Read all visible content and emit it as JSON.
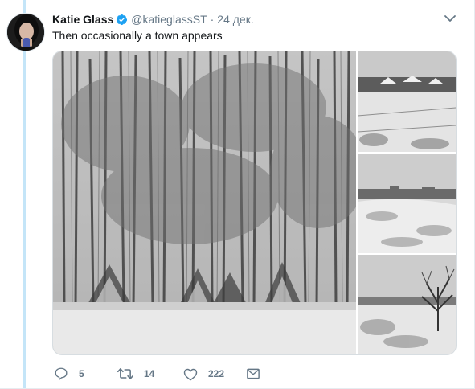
{
  "tweet": {
    "author_name": "Katie Glass",
    "author_handle": "@katieglassST",
    "separator": "·",
    "timestamp": "24 дек.",
    "text": "Then occasionally a town appears",
    "verified": true
  },
  "media": {
    "photos": [
      {
        "subject": "snowy birch forest"
      },
      {
        "subject": "snowy village houses"
      },
      {
        "subject": "snowy field with village"
      },
      {
        "subject": "snowy field with bare tree"
      }
    ]
  },
  "actions": {
    "reply_count": "5",
    "retweet_count": "14",
    "like_count": "222"
  },
  "icons": {
    "verified": "verified-badge-icon",
    "caret": "chevron-down-icon",
    "reply": "reply-icon",
    "retweet": "retweet-icon",
    "like": "heart-icon",
    "dm": "envelope-icon"
  },
  "colors": {
    "verified_blue": "#1da1f2",
    "secondary_text": "#657786",
    "primary_text": "#14171a",
    "thread_line": "#c4e5f8"
  }
}
